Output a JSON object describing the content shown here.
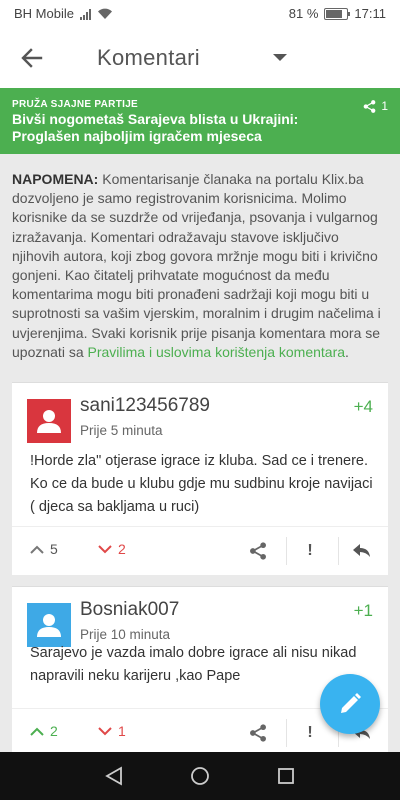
{
  "status": {
    "carrier": "BH Mobile",
    "battery": "81 %",
    "battery_level": 0.81,
    "time": "17:11"
  },
  "app_bar": {
    "title": "Komentari",
    "icons": {
      "back": "arrow-left-icon",
      "dropdown": "caret-down-icon"
    }
  },
  "article": {
    "kicker": "PRUŽA SJAJNE PARTIJE",
    "headline": "Bivši nogometaš Sarajeva blista u Ukrajini: Proglašen najboljim igračem mjeseca",
    "share_count": "1",
    "color": "#4caf50"
  },
  "notice": {
    "label": "NAPOMENA:",
    "text": " Komentarisanje članaka na portalu Klix.ba dozvoljeno je samo registrovanim korisnicima. Molimo korisnike da se suzdrže od vrijeđanja, psovanja i vulgarnog izražavanja. Komentari odražavaju stavove isključivo njihovih autora, koji zbog govora mržnje mogu biti i krivično gonjeni. Kao čitatelj prihvatate mogućnost da među komentarima mogu biti pronađeni sadržaji koji mogu biti u suprotnosti sa vašim vjerskim, moralnim i drugim načelima i uvjerenjima. Svaki korisnik prije pisanja komentara mora se upoznati sa ",
    "link": "Pravilima i uslovima korištenja komentara",
    "end": "."
  },
  "comments": [
    {
      "username": "sani123456789",
      "time": "Prije 5 minuta",
      "score": "+4",
      "text": "!Horde zla\"  otjerase igrace iz kluba. Sad ce i trenere. Ko ce da bude u klubu gdje mu sudbinu kroje navijaci ( djeca sa bakljama u ruci)",
      "upvotes": "5",
      "downvotes": "2",
      "avatar_color": "#d9363e",
      "report": "!"
    },
    {
      "username": "Bosniak007",
      "time": "Prije 10 minuta",
      "score": "+1",
      "text": "Sarajevo je vazda imalo dobre igrace ali nisu nikad napravili neku karijeru ,kao Pape",
      "upvotes": "2",
      "downvotes": "1",
      "avatar_color": "#3ea9e6",
      "report": "!"
    }
  ],
  "fab": {
    "icon": "pencil-icon",
    "color": "#39b3f0"
  }
}
